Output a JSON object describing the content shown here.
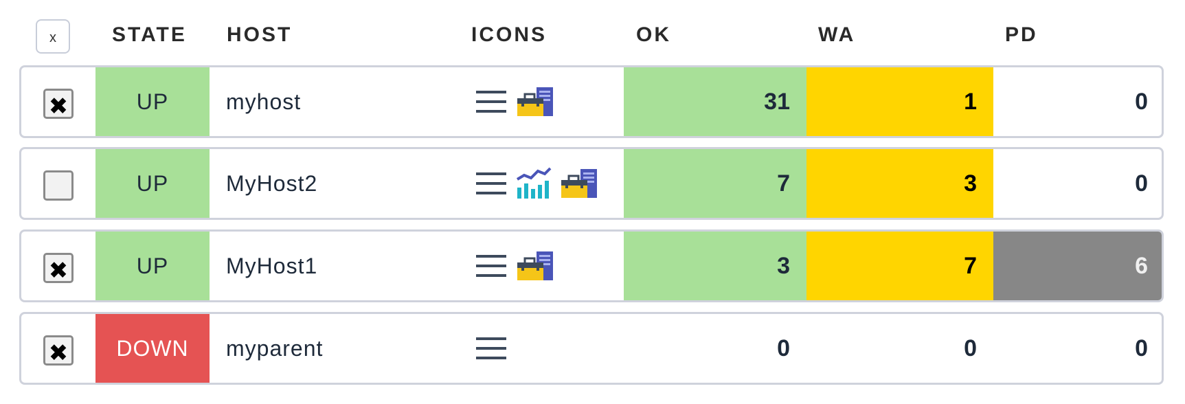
{
  "header": {
    "select_all_label": "x",
    "columns": {
      "state": "STATE",
      "host": "HOST",
      "icons": "ICONS",
      "ok": "OK",
      "wa": "WA",
      "pd": "PD"
    }
  },
  "colors": {
    "state_up": "#a8e098",
    "state_down": "#e55353",
    "ok_bg": "#a8e098",
    "warning_bg": "#ffd500",
    "pending_bg": "#878787"
  },
  "rows": [
    {
      "checked": true,
      "checkbox_mark": "✖",
      "state": "UP",
      "host": "myhost",
      "icons": [
        "menu-icon",
        "service-toolkit-icon"
      ],
      "ok": "31",
      "wa": "1",
      "pd": "0"
    },
    {
      "checked": false,
      "checkbox_mark": "",
      "state": "UP",
      "host": "MyHost2",
      "icons": [
        "menu-icon",
        "performance-graph-icon",
        "service-toolkit-icon"
      ],
      "ok": "7",
      "wa": "3",
      "pd": "0"
    },
    {
      "checked": true,
      "checkbox_mark": "✖",
      "state": "UP",
      "host": "MyHost1",
      "icons": [
        "menu-icon",
        "service-toolkit-icon"
      ],
      "ok": "3",
      "wa": "7",
      "pd": "6"
    },
    {
      "checked": true,
      "checkbox_mark": "✖",
      "state": "DOWN",
      "host": "myparent",
      "icons": [
        "menu-icon"
      ],
      "ok": "0",
      "wa": "0",
      "pd": "0"
    }
  ]
}
